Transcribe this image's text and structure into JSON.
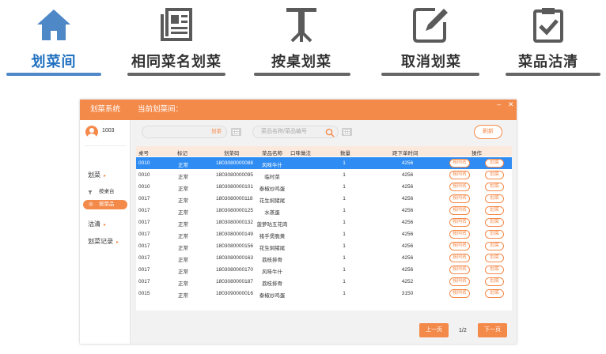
{
  "tabs": [
    {
      "label": "划菜间",
      "icon": "house-icon",
      "active": true
    },
    {
      "label": "相同菜名划菜",
      "icon": "newspaper-icon",
      "active": false
    },
    {
      "label": "按桌划菜",
      "icon": "table-icon",
      "active": false
    },
    {
      "label": "取消划菜",
      "icon": "edit-icon",
      "active": false
    },
    {
      "label": "菜品沽清",
      "icon": "clipboard-check-icon",
      "active": false
    }
  ],
  "window": {
    "system_title": "划菜系统",
    "current_title": "当前划菜间：",
    "minimize": "–",
    "close": "✕"
  },
  "sidebar": {
    "user_id": "1003",
    "menu_huacai": "划菜",
    "sub_by_table": "按桌台",
    "sub_by_dish": "按菜品",
    "menu_guqing": "沽清",
    "menu_records": "划菜记录"
  },
  "toolbar": {
    "search1_placeholder": "",
    "search1_button": "划菜",
    "search2_placeholder": "菜品名称/菜品编号",
    "refresh": "刷新"
  },
  "table": {
    "headers": [
      "桌号",
      "标记",
      "划菜码",
      "菜品名称",
      "口味做法",
      "数量",
      "距下单时间",
      "操作"
    ],
    "rows": [
      {
        "table": "0010",
        "mark": "正常",
        "code": "1803080000088",
        "dish": "风味牛什",
        "flavor": "",
        "qty": "1",
        "time": "4256",
        "selected": true
      },
      {
        "table": "0010",
        "mark": "正常",
        "code": "1803080000095",
        "dish": "临时菜",
        "flavor": "",
        "qty": "1",
        "time": "4256",
        "selected": false
      },
      {
        "table": "0010",
        "mark": "正常",
        "code": "1803080000101",
        "dish": "泰椒炒鸡蛋",
        "flavor": "",
        "qty": "1",
        "time": "4256",
        "selected": false
      },
      {
        "table": "0017",
        "mark": "正常",
        "code": "1803080000118",
        "dish": "花生焖猪尾",
        "flavor": "",
        "qty": "1",
        "time": "4256",
        "selected": false
      },
      {
        "table": "0017",
        "mark": "正常",
        "code": "1803080000125",
        "dish": "水蒸蛋",
        "flavor": "",
        "qty": "1",
        "time": "4256",
        "selected": false
      },
      {
        "table": "0017",
        "mark": "正常",
        "code": "1803080000132",
        "dish": "菠萝咕五花肉",
        "flavor": "",
        "qty": "1",
        "time": "4256",
        "selected": false
      },
      {
        "table": "0017",
        "mark": "正常",
        "code": "1803080000149",
        "dish": "猪手煲脆黄",
        "flavor": "",
        "qty": "1",
        "time": "4256",
        "selected": false
      },
      {
        "table": "0017",
        "mark": "正常",
        "code": "1803080000156",
        "dish": "花生焖猪尾",
        "flavor": "",
        "qty": "1",
        "time": "4256",
        "selected": false
      },
      {
        "table": "0017",
        "mark": "正常",
        "code": "1803080000163",
        "dish": "荔枝排骨",
        "flavor": "",
        "qty": "1",
        "time": "4256",
        "selected": false
      },
      {
        "table": "0017",
        "mark": "正常",
        "code": "1803080000170",
        "dish": "风味牛什",
        "flavor": "",
        "qty": "1",
        "time": "4256",
        "selected": false
      },
      {
        "table": "0017",
        "mark": "正常",
        "code": "1803080000187",
        "dish": "荔枝排骨",
        "flavor": "",
        "qty": "1",
        "time": "4252",
        "selected": false
      },
      {
        "table": "0015",
        "mark": "正常",
        "code": "1803090000016",
        "dish": "泰椒炒鸡蛋",
        "flavor": "",
        "qty": "1",
        "time": "3150",
        "selected": false
      }
    ],
    "action_same": "按同名",
    "action_mark": "划菜"
  },
  "pager": {
    "prev": "上一页",
    "info": "1/2",
    "next": "下一页"
  },
  "colors": {
    "accent": "#f48a4a",
    "selected_row": "#2f8cf3",
    "active_tab": "#1f6fbf",
    "icon_blue": "#4e88c7",
    "icon_gray": "#5a5a5a"
  }
}
